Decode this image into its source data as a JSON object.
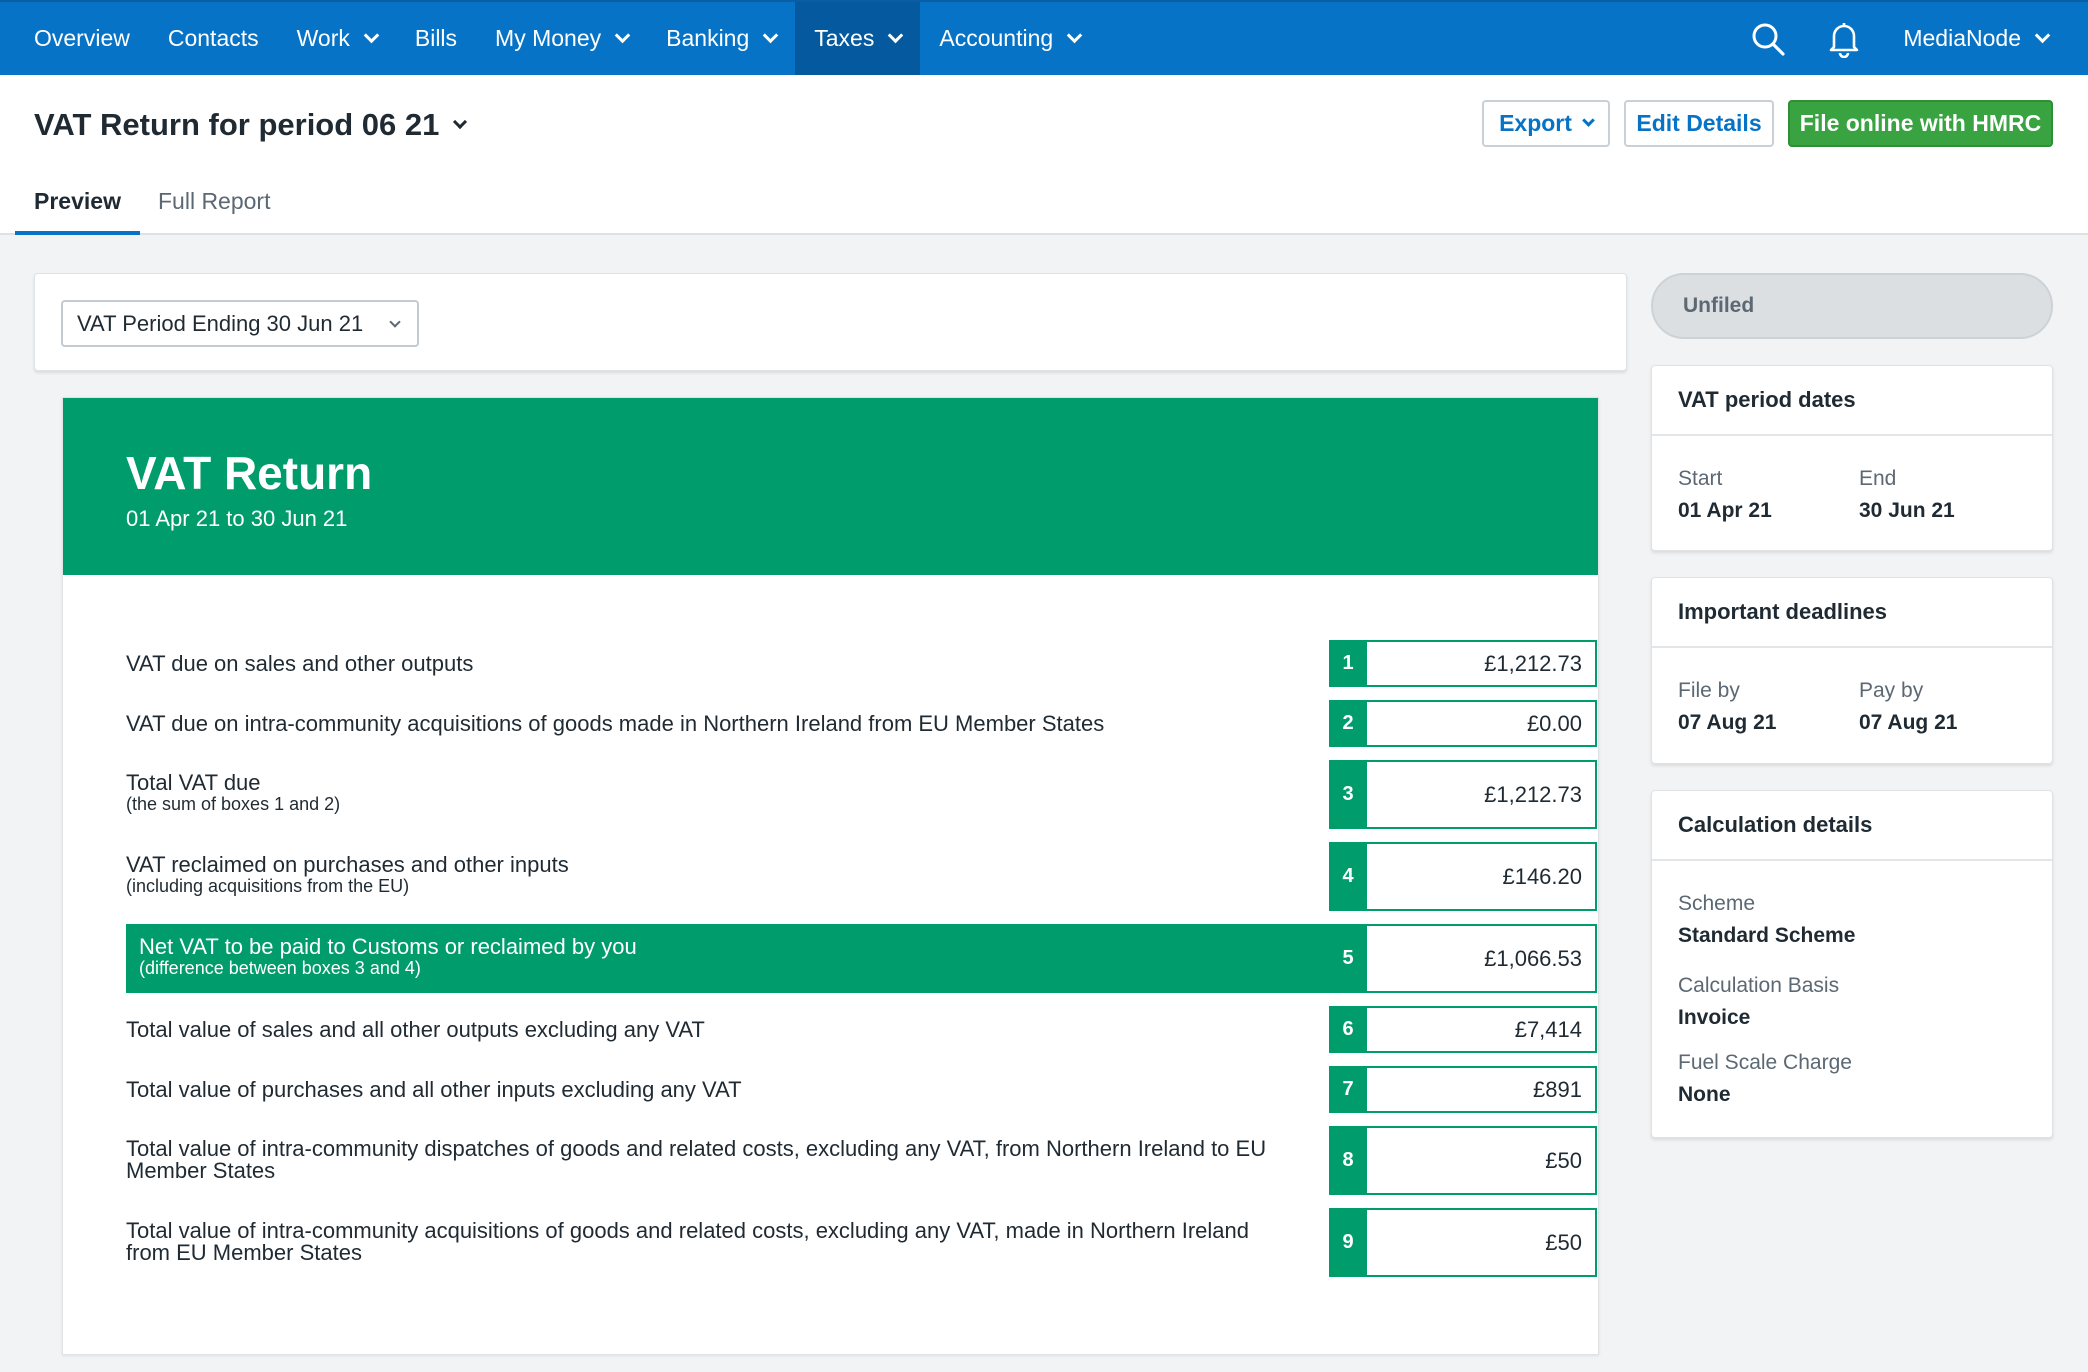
{
  "nav": {
    "items": [
      {
        "label": "Overview",
        "dropdown": false
      },
      {
        "label": "Contacts",
        "dropdown": false
      },
      {
        "label": "Work",
        "dropdown": true
      },
      {
        "label": "Bills",
        "dropdown": false
      },
      {
        "label": "My Money",
        "dropdown": true
      },
      {
        "label": "Banking",
        "dropdown": true
      },
      {
        "label": "Taxes",
        "dropdown": true,
        "active": true
      },
      {
        "label": "Accounting",
        "dropdown": true
      }
    ],
    "org_name": "MediaNode",
    "search_icon": "search-icon",
    "notification_icon": "bell-icon"
  },
  "header": {
    "title": "VAT Return for period 06 21",
    "export_label": "Export",
    "edit_label": "Edit Details",
    "file_label": "File online with HMRC",
    "tabs": [
      {
        "label": "Preview",
        "active": true
      },
      {
        "label": "Full Report",
        "active": false
      }
    ]
  },
  "period_select": {
    "value": "VAT Period Ending 30 Jun 21"
  },
  "report": {
    "title": "VAT Return",
    "dates": "01 Apr 21 to 30 Jun 21",
    "boxes": [
      {
        "num": "1",
        "desc": "VAT due on sales and other outputs",
        "sub": "",
        "value": "£1,212.73"
      },
      {
        "num": "2",
        "desc": "VAT due on intra-community acquisitions of goods made in Northern Ireland from EU Member States",
        "sub": "",
        "value": "£0.00"
      },
      {
        "num": "3",
        "desc": "Total VAT due",
        "sub": "(the sum of boxes 1 and 2)",
        "value": "£1,212.73"
      },
      {
        "num": "4",
        "desc": "VAT reclaimed on purchases and other inputs",
        "sub": "(including acquisitions from the EU)",
        "value": "£146.20"
      },
      {
        "num": "5",
        "desc": "Net VAT to be paid to Customs or reclaimed by you",
        "sub": "(difference between boxes 3 and 4)",
        "value": "£1,066.53"
      },
      {
        "num": "6",
        "desc": "Total value of sales and all other outputs excluding any VAT",
        "sub": "",
        "value": "£7,414"
      },
      {
        "num": "7",
        "desc": "Total value of purchases and all other inputs excluding any VAT",
        "sub": "",
        "value": "£891"
      },
      {
        "num": "8",
        "desc": "Total value of intra-community dispatches of goods and related costs, excluding any VAT, from Northern Ireland to EU Member States",
        "sub": "",
        "value": "£50"
      },
      {
        "num": "9",
        "desc": "Total value of intra-community acquisitions of goods and related costs, excluding any VAT, made in Northern Ireland from EU Member States",
        "sub": "",
        "value": "£50"
      }
    ]
  },
  "sidebar": {
    "status": "Unfiled",
    "period_dates": {
      "title": "VAT period dates",
      "start_label": "Start",
      "start_value": "01 Apr 21",
      "end_label": "End",
      "end_value": "30 Jun 21"
    },
    "deadlines": {
      "title": "Important deadlines",
      "file_label": "File by",
      "file_value": "07 Aug 21",
      "pay_label": "Pay by",
      "pay_value": "07 Aug 21"
    },
    "calculation": {
      "title": "Calculation details",
      "scheme_label": "Scheme",
      "scheme_value": "Standard Scheme",
      "basis_label": "Calculation Basis",
      "basis_value": "Invoice",
      "fuel_label": "Fuel Scale Charge",
      "fuel_value": "None"
    }
  },
  "colors": {
    "nav_blue": "#0773c6",
    "nav_active": "#05599e",
    "vat_green": "#009c6b",
    "file_button_green": "#39a341"
  }
}
